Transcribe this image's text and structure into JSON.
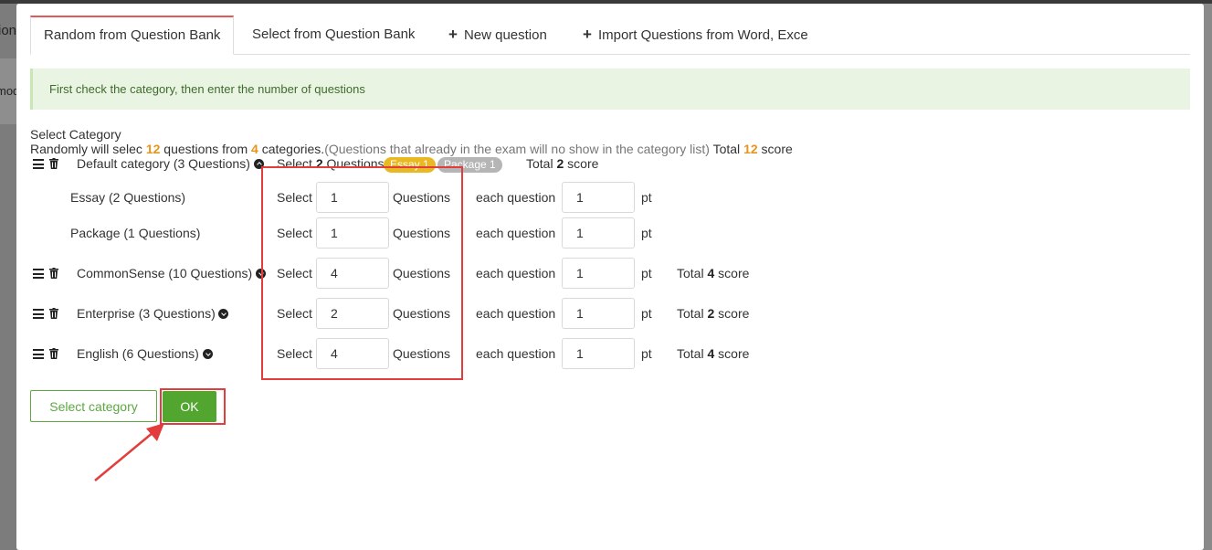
{
  "background": {
    "fragments": [
      "ion",
      "mod"
    ]
  },
  "tabs": [
    {
      "label": "Random from Question Bank",
      "active": true
    },
    {
      "label": "Select from Question Bank",
      "active": false
    },
    {
      "label": "New question",
      "active": false
    },
    {
      "label": "Import Questions from Word, Exce",
      "active": false
    }
  ],
  "alert": "First check the category, then enter the number of questions",
  "summary": {
    "heading": "Select Category",
    "prefix": "Randomly will selec",
    "question_count": "12",
    "mid": "questions from",
    "category_count": "4",
    "categories_word": "categories.",
    "note": "(Questions that already in the exam will no show in the category list)",
    "total_label": "Total",
    "total_score": "12",
    "score_word": "score"
  },
  "labels": {
    "select": "Select",
    "questions": "Questions",
    "each_question": "each question",
    "pt": "pt",
    "total": "Total",
    "score": "score"
  },
  "default_category": {
    "name": "Default category (3 Questions)",
    "select_count": "2",
    "badges": [
      "Essay 1",
      "Package 1"
    ],
    "total": "2",
    "subtypes": [
      {
        "name": "Essay (2 Questions)",
        "count": "1",
        "points": "1"
      },
      {
        "name": "Package (1 Questions)",
        "count": "1",
        "points": "1"
      }
    ]
  },
  "categories": [
    {
      "name": "CommonSense (10 Questions)",
      "count": "4",
      "points": "1",
      "total": "4"
    },
    {
      "name": "Enterprise (3 Questions)",
      "count": "2",
      "points": "1",
      "total": "2"
    },
    {
      "name": "English (6 Questions)",
      "count": "4",
      "points": "1",
      "total": "4"
    }
  ],
  "buttons": {
    "select_category": "Select category",
    "ok": "OK"
  },
  "colors": {
    "accent_green": "#52a52e",
    "highlight_red": "#e23c3c",
    "count_orange": "#e8941a",
    "tab_active_border": "#e05a5a"
  }
}
